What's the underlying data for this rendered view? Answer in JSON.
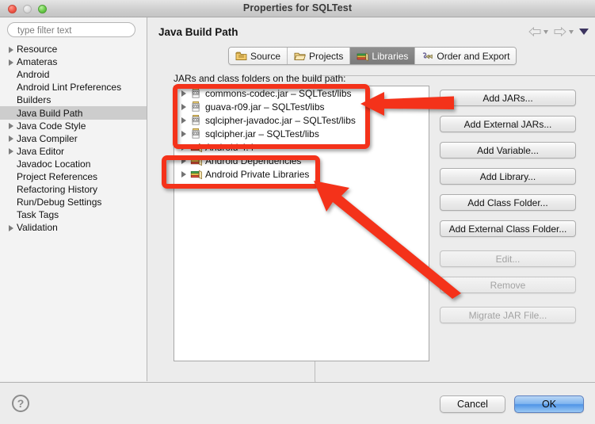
{
  "window": {
    "title": "Properties for SQLTest",
    "traffic_lights": [
      "close-red",
      "minimize-disabled",
      "zoom-green"
    ]
  },
  "sidebar": {
    "filter": {
      "placeholder": "type filter text",
      "value": ""
    },
    "items": [
      {
        "label": "Resource",
        "expandable": true,
        "selected": false
      },
      {
        "label": "Amateras",
        "expandable": true,
        "selected": false
      },
      {
        "label": "Android",
        "expandable": false,
        "selected": false
      },
      {
        "label": "Android Lint Preferences",
        "expandable": false,
        "selected": false
      },
      {
        "label": "Builders",
        "expandable": false,
        "selected": false
      },
      {
        "label": "Java Build Path",
        "expandable": false,
        "selected": true
      },
      {
        "label": "Java Code Style",
        "expandable": true,
        "selected": false
      },
      {
        "label": "Java Compiler",
        "expandable": true,
        "selected": false
      },
      {
        "label": "Java Editor",
        "expandable": true,
        "selected": false
      },
      {
        "label": "Javadoc Location",
        "expandable": false,
        "selected": false
      },
      {
        "label": "Project References",
        "expandable": false,
        "selected": false
      },
      {
        "label": "Refactoring History",
        "expandable": false,
        "selected": false
      },
      {
        "label": "Run/Debug Settings",
        "expandable": false,
        "selected": false
      },
      {
        "label": "Task Tags",
        "expandable": false,
        "selected": false
      },
      {
        "label": "Validation",
        "expandable": true,
        "selected": false
      }
    ]
  },
  "pane": {
    "title": "Java Build Path",
    "nav": {
      "back_icon": "back-arrow-icon",
      "back_caret_icon": "chevron-down-icon",
      "forward_icon": "forward-arrow-icon",
      "forward_caret_icon": "chevron-down-icon",
      "menu_icon": "view-menu-caret-icon"
    },
    "tabs": [
      {
        "label": "Source",
        "icon": "source-folder-icon",
        "active": false
      },
      {
        "label": "Projects",
        "icon": "projects-folder-icon",
        "active": false
      },
      {
        "label": "Libraries",
        "icon": "libraries-books-icon",
        "active": true
      },
      {
        "label": "Order and Export",
        "icon": "order-export-icon",
        "active": false
      }
    ],
    "list_label": "JARs and class folders on the build path:",
    "libraries": [
      {
        "name": "commons-codec.jar – SQLTest/libs",
        "icon": "jar-icon",
        "expandable": true
      },
      {
        "name": "guava-r09.jar – SQLTest/libs",
        "icon": "jar-icon",
        "expandable": true
      },
      {
        "name": "sqlcipher-javadoc.jar – SQLTest/libs",
        "icon": "jar-icon",
        "expandable": true
      },
      {
        "name": "sqlcipher.jar – SQLTest/libs",
        "icon": "jar-icon",
        "expandable": true
      },
      {
        "name": "Android 4.4",
        "icon": "library-icon",
        "expandable": true
      },
      {
        "name": "Android Dependencies",
        "icon": "library-icon",
        "expandable": true
      },
      {
        "name": "Android Private Libraries",
        "icon": "library-icon",
        "expandable": true
      }
    ],
    "buttons": [
      {
        "label": "Add JARs...",
        "disabled": false,
        "group": 1
      },
      {
        "label": "Add External JARs...",
        "disabled": false,
        "group": 1
      },
      {
        "label": "Add Variable...",
        "disabled": false,
        "group": 1
      },
      {
        "label": "Add Library...",
        "disabled": false,
        "group": 1
      },
      {
        "label": "Add Class Folder...",
        "disabled": false,
        "group": 1
      },
      {
        "label": "Add External Class Folder...",
        "disabled": false,
        "group": 1
      },
      {
        "label": "Edit...",
        "disabled": true,
        "group": 2
      },
      {
        "label": "Remove",
        "disabled": true,
        "group": 2
      },
      {
        "label": "Migrate JAR File...",
        "disabled": true,
        "group": 3
      }
    ]
  },
  "footer": {
    "help_label": "?",
    "cancel_label": "Cancel",
    "ok_label": "OK"
  },
  "annotations": {
    "color": "#f4321a",
    "boxes": [
      {
        "name": "jars-highlight",
        "targets": "four jar entries"
      },
      {
        "name": "android-libs-highlight",
        "targets": "Android Dependencies and Android Private Libraries"
      }
    ],
    "arrows": [
      {
        "name": "arrow-to-jars",
        "from": "Add JARs button",
        "to": "jar list entries"
      },
      {
        "name": "arrow-to-libs",
        "from": "Remove button",
        "to": "android libraries box"
      }
    ]
  }
}
